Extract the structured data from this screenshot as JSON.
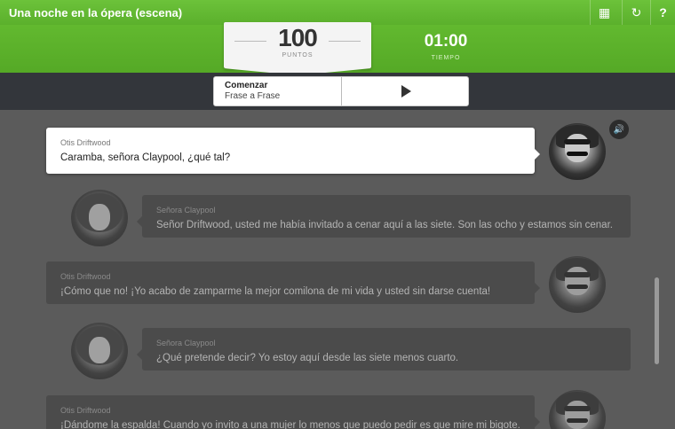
{
  "header": {
    "title": "Una noche en la ópera (escena)",
    "buttons": [
      {
        "name": "calendar-icon",
        "glyph": "▦"
      },
      {
        "name": "refresh-icon",
        "glyph": "↻"
      },
      {
        "name": "help-icon",
        "glyph": "?"
      }
    ]
  },
  "score": {
    "points": "100",
    "points_label": "PUNTOS"
  },
  "timer": {
    "value": "01:00",
    "label": "TIEMPO"
  },
  "controls": {
    "mode_title": "Comenzar",
    "mode_sub": "Frase a Frase"
  },
  "colors": {
    "accent_green": "#5bb02c",
    "dark_band": "#33363b",
    "background": "#5b5b5b"
  },
  "dialogue": [
    {
      "speaker": "Otis Driftwood",
      "line": "Caramba, señora Claypool, ¿qué tal?",
      "active": true
    },
    {
      "speaker": "Señora Claypool",
      "line": "Señor Driftwood, usted me había invitado a cenar aquí a las siete. Son las ocho y estamos sin cenar.",
      "active": false
    },
    {
      "speaker": "Otis Driftwood",
      "line": "¡Cómo que no! ¡Yo acabo de zamparme la mejor comilona de mi vida y usted sin darse cuenta!",
      "active": false
    },
    {
      "speaker": "Señora Claypool",
      "line": "¿Qué pretende decir? Yo estoy aquí desde las siete menos cuarto.",
      "active": false
    },
    {
      "speaker": "Otis Driftwood",
      "line": "¡Dándome la espalda! Cuando yo invito a una mujer lo menos que puedo pedir es que mire mi bigote. Es",
      "active": false
    }
  ]
}
